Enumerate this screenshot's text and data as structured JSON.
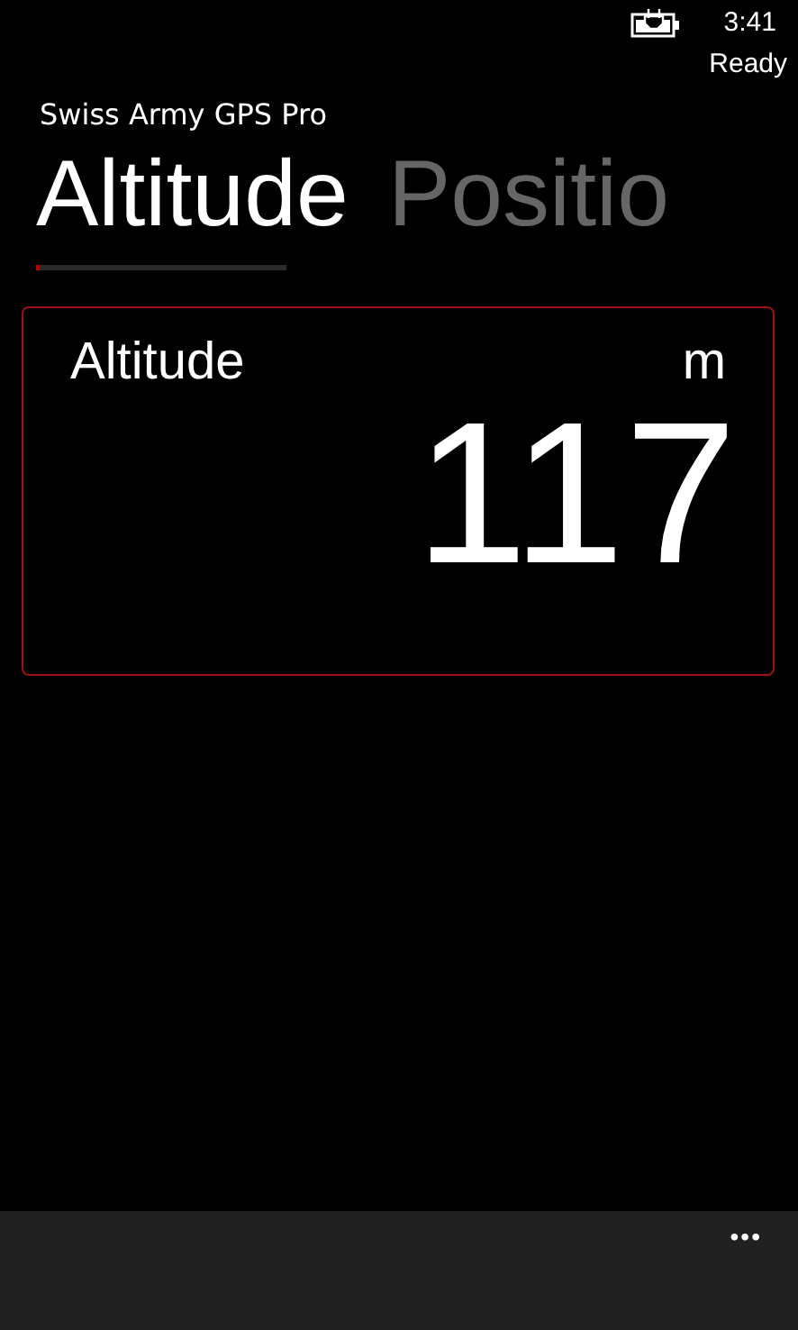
{
  "status_bar": {
    "time": "3:41",
    "status": "Ready"
  },
  "app_title": "Swiss Army GPS Pro",
  "pivot_headers": [
    {
      "label": "Altitude",
      "selected": true
    },
    {
      "label": "Positio",
      "selected": false
    }
  ],
  "altitude_card": {
    "label": "Altitude",
    "unit": "m",
    "value": "117"
  },
  "app_bar": {
    "more": "•••"
  }
}
